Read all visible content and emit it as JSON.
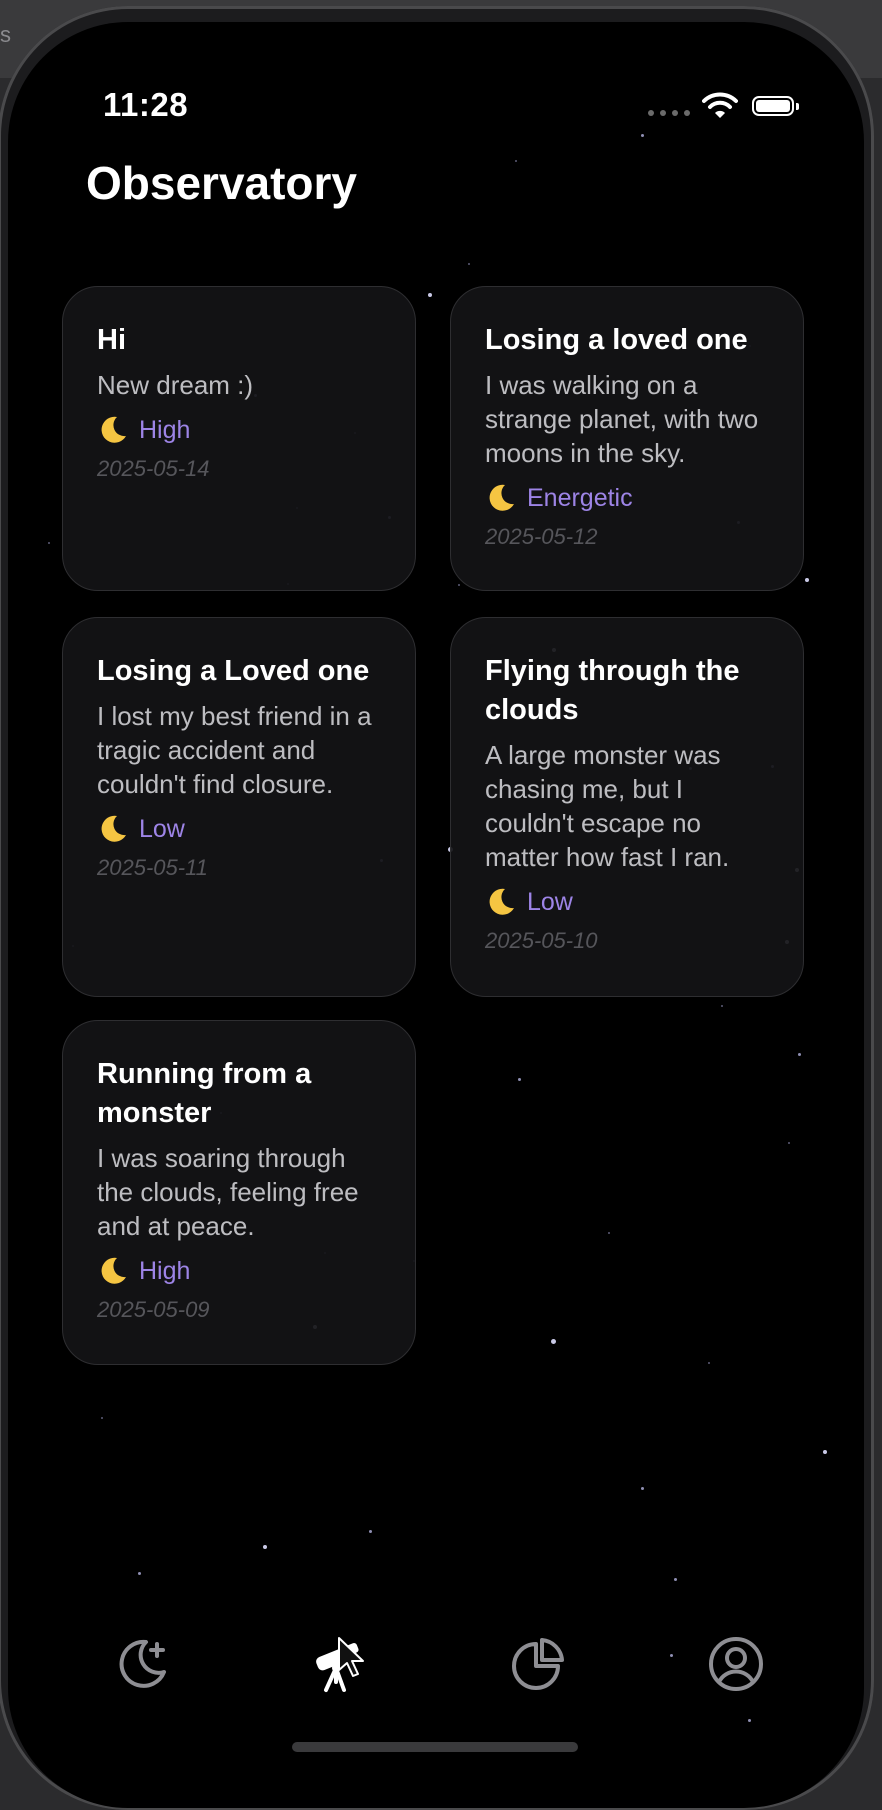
{
  "desk": {
    "edge_glyph": "s"
  },
  "status_bar": {
    "time": "11:28"
  },
  "header": {
    "title": "Observatory"
  },
  "mood_icon": "crescent-moon-icon",
  "accent_color": "#9d84e6",
  "dreams": [
    {
      "title": "Hi",
      "body": "New dream :)",
      "mood": "High",
      "date": "2025-05-14"
    },
    {
      "title": "Losing a loved one",
      "body": "I was walking on a strange planet, with two moons in the sky.",
      "mood": "Energetic",
      "date": "2025-05-12"
    },
    {
      "title": "Losing a Loved one",
      "body": "I lost my best friend in a tragic accident and couldn't find closure.",
      "mood": "Low",
      "date": "2025-05-11"
    },
    {
      "title": "Flying through the clouds",
      "body": "A large monster was chasing me, but I couldn't escape no matter how fast I ran.",
      "mood": "Low",
      "date": "2025-05-10"
    },
    {
      "title": "Running from a monster",
      "body": "I was soaring through the clouds, feeling free and at peace.",
      "mood": "High",
      "date": "2025-05-09"
    }
  ],
  "tabbar": {
    "tabs": [
      {
        "icon": "moon-plus-icon",
        "active": false
      },
      {
        "icon": "telescope-icon",
        "active": true
      },
      {
        "icon": "pie-chart-icon",
        "active": false
      },
      {
        "icon": "user-circle-icon",
        "active": false
      }
    ]
  }
}
